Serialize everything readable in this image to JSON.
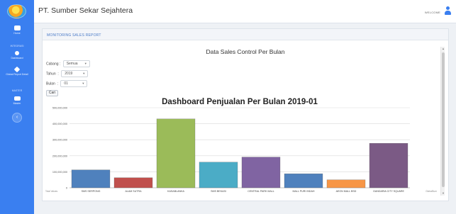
{
  "app": {
    "company_name": "PT. Sumber Sekar Sejahtera",
    "welcome": "WELCOME",
    "brand_color": "#3a7ff0"
  },
  "sidebar": {
    "items": [
      {
        "label": "Home",
        "icon": "home-icon"
      },
      {
        "heading": "INTEGRASI"
      },
      {
        "label": "Dashboard",
        "icon": "dashboard-icon"
      },
      {
        "label": "Global Report Detail",
        "icon": "report-icon"
      },
      {
        "heading": "MASTER"
      },
      {
        "label": "Master",
        "icon": "master-icon"
      }
    ],
    "toggle_label": "‹"
  },
  "card": {
    "header_title": "MONITORING SALES REPORT",
    "report_title": "Data Sales Control Per Bulan"
  },
  "filters": {
    "cabang_label": "Cabang",
    "cabang_value": "Semua",
    "tahun_label": "Tahun",
    "tahun_value": "2019",
    "bulan_label": "Bulan",
    "bulan_value": "01",
    "submit_label": "Cari"
  },
  "chart_data": {
    "type": "bar",
    "title": "Dashboard Penjualan Per Bulan 2019-01",
    "categories": [
      "SMS SERPONG",
      "ALAM SUTRA",
      "KASABLANKA",
      "SMS BEKASI",
      "CENTRAL PARK MALL",
      "MALL PURI INDAH",
      "AEON MALL BSD",
      "GANDARIA CITY SQUARE"
    ],
    "values": [
      112000000,
      63000000,
      430000000,
      160000000,
      192000000,
      88000000,
      50000000,
      278000000
    ],
    "colors": [
      "#4f81bd",
      "#c0504d",
      "#9bbb59",
      "#4bacc6",
      "#8064a2",
      "#4f81bd",
      "#f79646",
      "#7b5a85"
    ],
    "ylim": [
      0,
      500000000
    ],
    "yticks": [
      "0",
      "100,000,000",
      "200,000,000",
      "300,000,000",
      "400,000,000",
      "500,000,000"
    ],
    "grid": true,
    "footer_left": "Total Values",
    "footer_right": "GlobalSum"
  }
}
